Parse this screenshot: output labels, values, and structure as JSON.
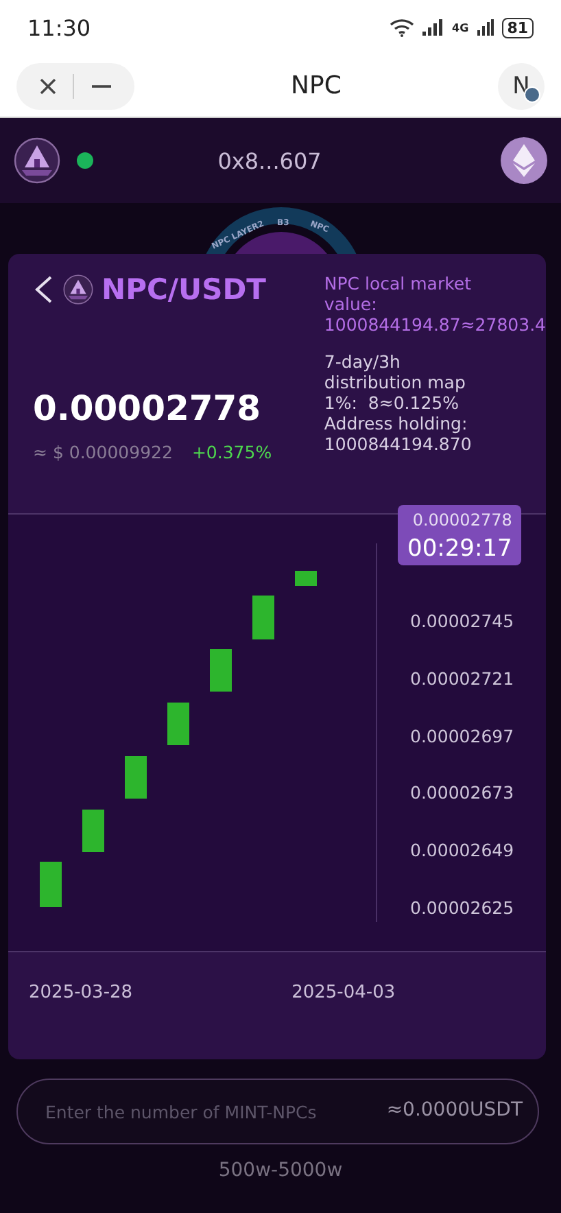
{
  "status_bar": {
    "time": "11:30",
    "network": "4G",
    "battery": "81"
  },
  "browser_bar": {
    "title": "NPC",
    "avatar_letter": "N"
  },
  "header": {
    "address": "0x8...607",
    "online": true
  },
  "emblem_text": [
    "NPC LAYER2",
    "B3",
    "NPC"
  ],
  "pair": {
    "title": "NPC/USDT",
    "price": "0.00002778",
    "usd_price": "≈ $ 0.00009922",
    "change": "+0.375%"
  },
  "info": {
    "market_value_label": "NPC local market value:",
    "market_value": "1000844194.87≈27803.4",
    "map_label": "7-day/3h distribution map",
    "ratio": "1%:  8≈0.125%",
    "holding_label": "Address holding:",
    "holding": "1000844194.870"
  },
  "chart": {
    "current_price": "0.00002778",
    "countdown": "00:29:17",
    "y_labels": [
      "0.00002745",
      "0.00002721",
      "0.00002697",
      "0.00002673",
      "0.00002649",
      "0.00002625"
    ],
    "x_labels": [
      "2025-03-28",
      "2025-04-03"
    ]
  },
  "mint": {
    "placeholder": "Enter the number of MINT-NPCs",
    "estimate": "≈0.0000USDT",
    "range": "500w-5000w"
  }
}
